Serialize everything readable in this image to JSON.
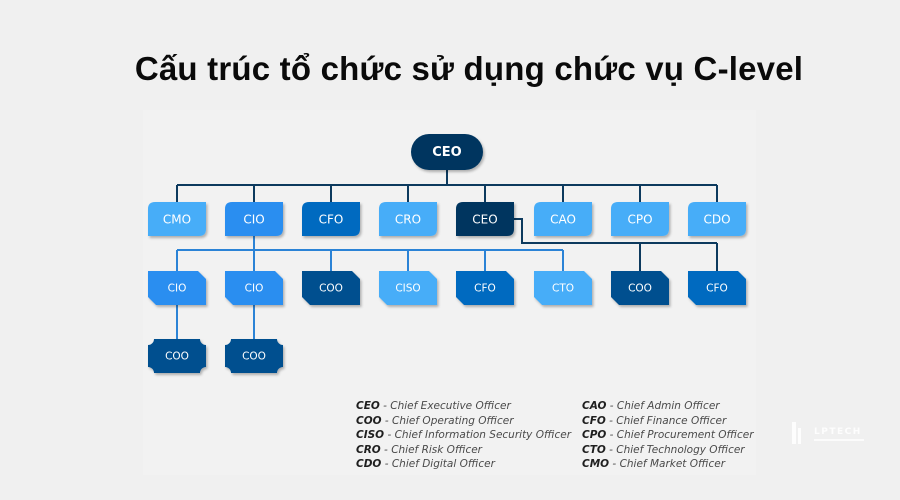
{
  "title": "Cấu trúc tổ chức sử dụng chức vụ C-level",
  "colors": {
    "navy": "#04365e",
    "dark_blue": "#02508f",
    "blue": "#036bc0",
    "bright_blue": "#2a8ef0",
    "light_blue": "#46adf8",
    "line_navy": "#0d3a5e",
    "line_blue": "#2b83d6"
  },
  "org_chart": {
    "root": {
      "id": "root",
      "label": "CEO",
      "color": "navy"
    },
    "level1": [
      {
        "id": "l1-cmo",
        "label": "CMO",
        "color": "light_blue"
      },
      {
        "id": "l1-cio",
        "label": "CIO",
        "color": "bright_blue"
      },
      {
        "id": "l1-cfo",
        "label": "CFO",
        "color": "blue"
      },
      {
        "id": "l1-cro",
        "label": "CRO",
        "color": "light_blue"
      },
      {
        "id": "l1-ceo",
        "label": "CEO",
        "color": "navy"
      },
      {
        "id": "l1-cao",
        "label": "CAO",
        "color": "light_blue"
      },
      {
        "id": "l1-cpo",
        "label": "CPO",
        "color": "light_blue"
      },
      {
        "id": "l1-cdo",
        "label": "CDO",
        "color": "light_blue"
      }
    ],
    "level2": [
      {
        "id": "l2-cio-a",
        "label": "CIO",
        "color": "bright_blue",
        "parent": "l1-cio"
      },
      {
        "id": "l2-cio-b",
        "label": "CIO",
        "color": "bright_blue",
        "parent": "l1-cio"
      },
      {
        "id": "l2-coo-a",
        "label": "COO",
        "color": "dark_blue",
        "parent": "l1-cio"
      },
      {
        "id": "l2-ciso",
        "label": "CISO",
        "color": "light_blue",
        "parent": "l1-cio"
      },
      {
        "id": "l2-cfo-a",
        "label": "CFO",
        "color": "blue",
        "parent": "l1-cio"
      },
      {
        "id": "l2-cto",
        "label": "CTO",
        "color": "light_blue",
        "parent": "l1-cio"
      },
      {
        "id": "l2-coo-b",
        "label": "COO",
        "color": "dark_blue",
        "parent": "l1-ceo"
      },
      {
        "id": "l2-cfo-b",
        "label": "CFO",
        "color": "blue",
        "parent": "l1-ceo"
      }
    ],
    "level3": [
      {
        "id": "l3-coo-a",
        "label": "COO",
        "color": "dark_blue",
        "parent": "l2-cio-a"
      },
      {
        "id": "l3-coo-b",
        "label": "COO",
        "color": "dark_blue",
        "parent": "l2-cio-b"
      }
    ]
  },
  "legend": {
    "left": [
      {
        "abbr": "CEO",
        "text": "Chief  Executive Officer"
      },
      {
        "abbr": "COO",
        "text": "Chief Operating Officer"
      },
      {
        "abbr": "CISO",
        "text": "Chief Information Security Officer"
      },
      {
        "abbr": "CRO",
        "text": "Chief Risk Officer"
      },
      {
        "abbr": "CDO",
        "text": "Chief Digital Officer"
      }
    ],
    "right": [
      {
        "abbr": "CAO",
        "text": "Chief Admin Officer"
      },
      {
        "abbr": "CFO",
        "text": "Chief Finance Officer"
      },
      {
        "abbr": "CPO",
        "text": "Chief Procurement Officer"
      },
      {
        "abbr": "CTO",
        "text": "Chief Technology Officer"
      },
      {
        "abbr": "CMO",
        "text": "Chief Market Officer"
      }
    ],
    "separator": " - "
  },
  "watermark": {
    "text": "LPTECH"
  }
}
